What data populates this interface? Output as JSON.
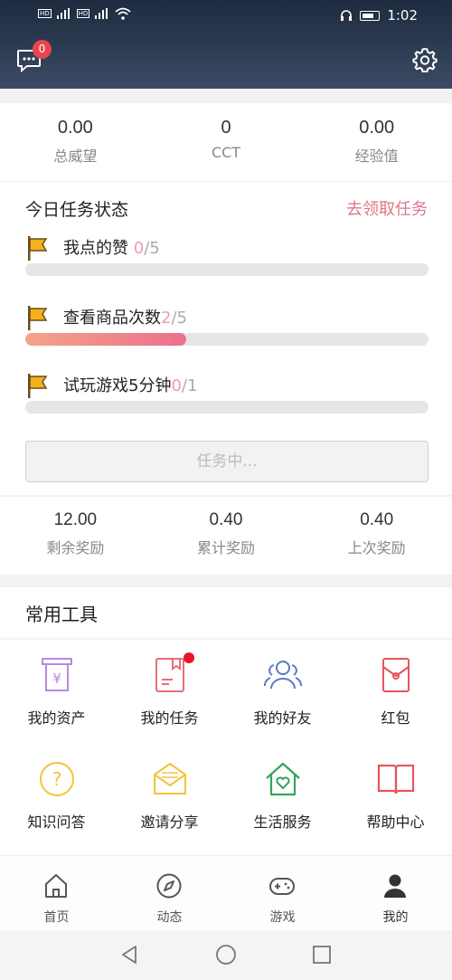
{
  "status_bar": {
    "network": "4G",
    "time": "1:02",
    "carrier_tag": "HD"
  },
  "header": {
    "message_badge": "0"
  },
  "stats": [
    {
      "value": "0.00",
      "label": "总威望"
    },
    {
      "value": "0",
      "label": "CCT"
    },
    {
      "value": "0.00",
      "label": "经验值"
    }
  ],
  "tasks": {
    "title": "今日任务状态",
    "link": "去领取任务",
    "items": [
      {
        "name": "我点的赞 ",
        "done": "0",
        "total": "/5",
        "progress": 0
      },
      {
        "name": "查看商品次数",
        "done": "2",
        "total": "/5",
        "progress": 0.4
      },
      {
        "name": "试玩游戏5分钟",
        "done": "0",
        "total": "/1",
        "progress": 0
      }
    ],
    "status_button": "任务中..."
  },
  "rewards": [
    {
      "value": "12.00",
      "label": "剩余奖励"
    },
    {
      "value": "0.40",
      "label": "累计奖励"
    },
    {
      "value": "0.40",
      "label": "上次奖励"
    }
  ],
  "tools": {
    "title": "常用工具",
    "items": [
      {
        "label": "我的资产",
        "icon": "assets-icon",
        "color": "#b78be0"
      },
      {
        "label": "我的任务",
        "icon": "task-book-icon",
        "color": "#e86d7d"
      },
      {
        "label": "我的好友",
        "icon": "friends-icon",
        "color": "#5a77c6"
      },
      {
        "label": "红包",
        "icon": "red-packet-icon",
        "color": "#e8545e"
      },
      {
        "label": "知识问答",
        "icon": "question-icon",
        "color": "#f2c43a"
      },
      {
        "label": "邀请分享",
        "icon": "envelope-icon",
        "color": "#f2c43a"
      },
      {
        "label": "生活服务",
        "icon": "home-heart-icon",
        "color": "#33a45b"
      },
      {
        "label": "帮助中心",
        "icon": "open-book-icon",
        "color": "#e8545e"
      }
    ]
  },
  "tabbar": [
    {
      "label": "首页",
      "icon": "home-icon"
    },
    {
      "label": "动态",
      "icon": "compass-icon"
    },
    {
      "label": "游戏",
      "icon": "gamepad-icon"
    },
    {
      "label": "我的",
      "icon": "profile-icon"
    }
  ],
  "colors": {
    "header": "#2b3850",
    "accent": "#e0758a",
    "badge": "#e8454d"
  }
}
